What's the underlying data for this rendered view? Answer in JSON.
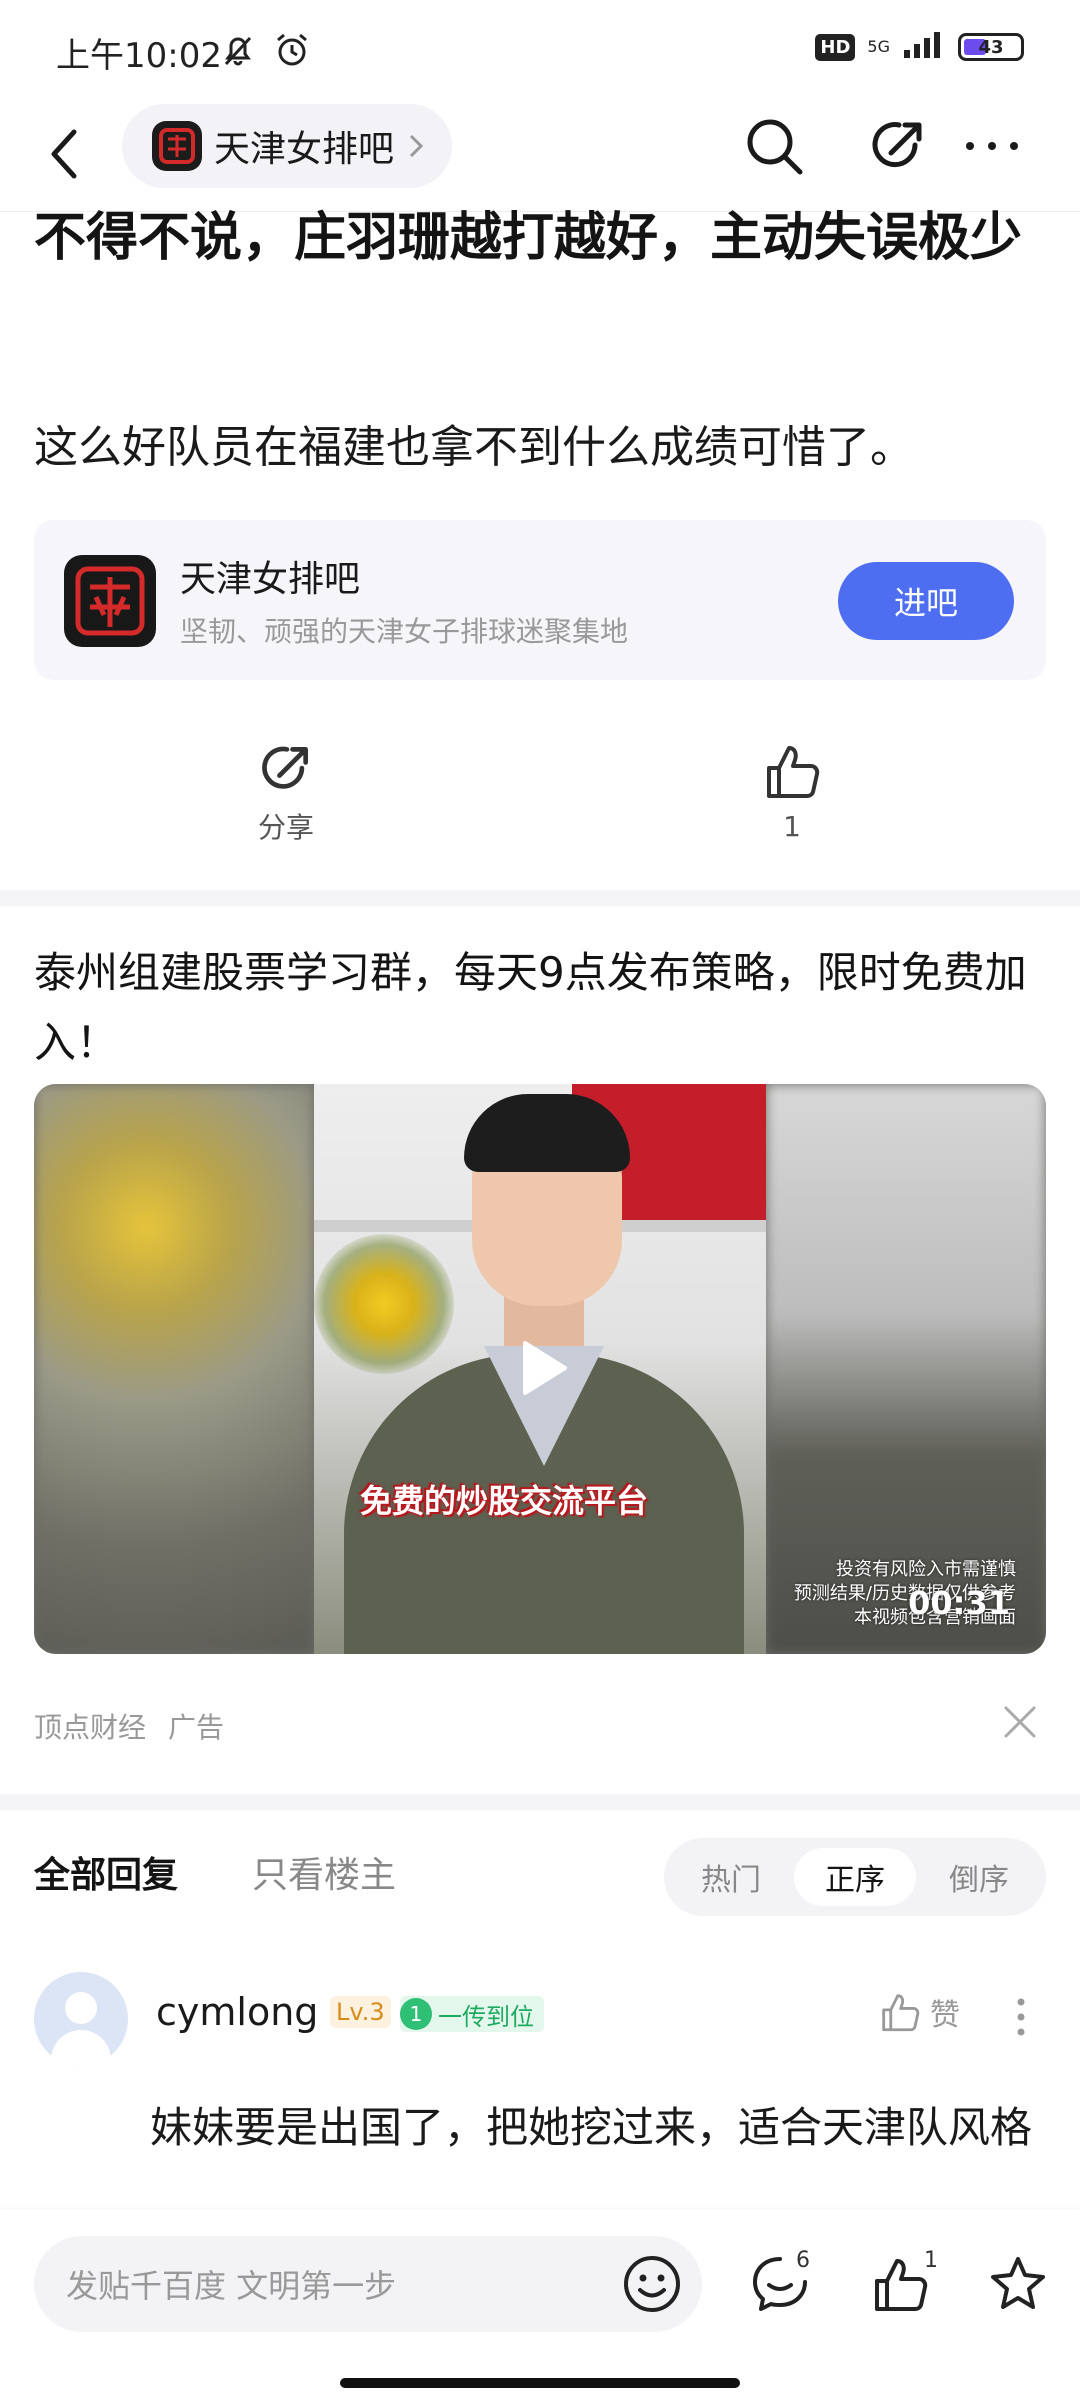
{
  "status_bar": {
    "time": "上午10:02",
    "hd": "HD",
    "network": "5G",
    "battery": "43",
    "icons": [
      "bell-off-icon",
      "alarm-icon",
      "signal-icon"
    ]
  },
  "nav": {
    "forum_name": "天津女排吧",
    "icons": [
      "back-icon",
      "search-icon",
      "share-icon",
      "more-icon"
    ]
  },
  "post": {
    "title": "不得不说，庄羽珊越打越好，主动失误极少",
    "body": "这么好队员在福建也拿不到什么成绩可惜了。"
  },
  "forum_card": {
    "name": "天津女排吧",
    "desc": "坚韧、顽强的天津女子排球迷聚集地",
    "join_label": "进吧"
  },
  "actions": {
    "share_label": "分享",
    "like_count": "1"
  },
  "ad": {
    "title": "泰州组建股票学习群，每天9点发布策略，限时免费加入！",
    "video_caption": "免费的炒股交流平台",
    "disclaimer_line1": "投资有风险入市需谨慎",
    "disclaimer_line2": "预测结果/历史数据仅供参考",
    "disclaimer_line3": "本视频包含营销画面",
    "duration": "00:31",
    "source": "顶点财经",
    "ad_label": "广告"
  },
  "replies": {
    "tab_all": "全部回复",
    "tab_op": "只看楼主",
    "sort_options": [
      "热门",
      "正序",
      "倒序"
    ],
    "sort_selected": "正序"
  },
  "comment": {
    "username": "cymlong",
    "level": "Lv.3",
    "badge_num": "1",
    "badge_text": "一传到位",
    "like_label": "赞",
    "text": "妹妹要是出国了，把她挖过来，适合天津队风格"
  },
  "bottom_bar": {
    "input_placeholder": "发贴千百度 文明第一步",
    "comment_count": "6",
    "like_count": "1"
  },
  "colors": {
    "accent": "#4e6ef2",
    "level_badge": "#d98b1a",
    "title_badge": "#2fbf75",
    "battery_fill": "#6c4bef"
  }
}
